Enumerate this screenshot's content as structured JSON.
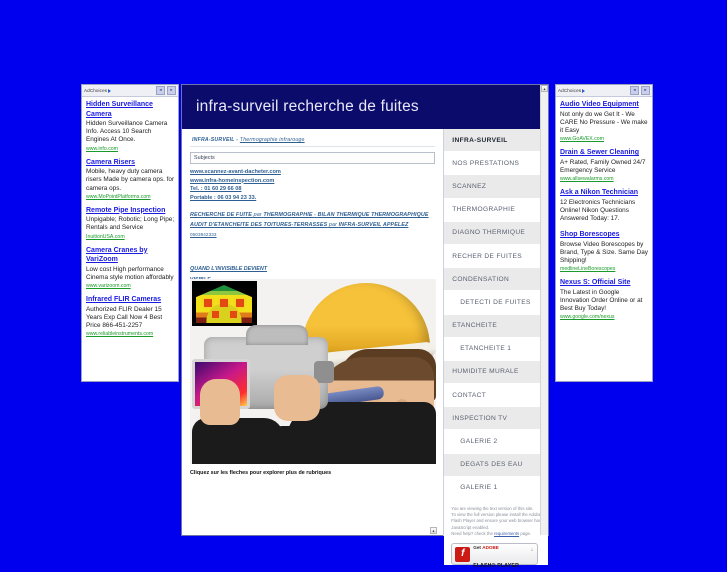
{
  "header": {
    "title": "infra-surveil recherche de fuites"
  },
  "ads_left": {
    "adchoices_label": "AdChoices",
    "prev_label": "◂",
    "next_label": "▸",
    "items": [
      {
        "title": "Hidden Surveillance Camera",
        "body": "Hidden Surveillance Camera Info. Access 10 Search Engines At Once.",
        "url": "www.info.com"
      },
      {
        "title": "Camera Risers",
        "body": "Mobile, heavy duty camera risers Made by camera ops. for camera ops.",
        "url": "www.MoPointPlatforms.com"
      },
      {
        "title": "Remote Pipe Inspection",
        "body": "Unpigable; Robotic; Long Pipe; Rentals and Service",
        "url": "InuitionUSA.com"
      },
      {
        "title": "Camera Cranes by VariZoom",
        "body": "Low cost High performance Cinema style motion affordably",
        "url": "www.varizoom.com"
      },
      {
        "title": "Infrared FLIR Cameras",
        "body": "Authorized FLIR Dealer 15 Years Exp Call Now 4 Best Price 866-451-2257",
        "url": "www.reliableinstruments.com"
      }
    ]
  },
  "ads_right": {
    "adchoices_label": "AdChoices",
    "prev_label": "◂",
    "next_label": "▸",
    "items": [
      {
        "title": "Audio Video Equipment",
        "body": "Not only do we Get It - We CARE No Pressure - We make it Easy",
        "url": "www.GoAVEX.com"
      },
      {
        "title": "Drain & Sewer Cleaning",
        "body": "A+ Rated, Family Owned 24/7 Emergency Service",
        "url": "www.allsewalarms.com"
      },
      {
        "title": "Ask a Nikon Technician",
        "body": "12 Electronics Technicians Online! Nikon Questions Answered Today: 17.",
        "url": ""
      },
      {
        "title": "Shop Borescopes",
        "body": "Browse Video Borescopes by Brand, Type & Size. Same Day Shipping!",
        "url": "medlineLineBorescopes"
      },
      {
        "title": "Nexus S: Official Site",
        "body": "The Latest in Google Innovation Order Online or at Best Buy Today!",
        "url": "www.google.com/nexus"
      }
    ]
  },
  "content": {
    "breadcrumb_site": "INFRA-SURVEIL",
    "breadcrumb_sep": "-",
    "breadcrumb_page": "Thermographie infrarouge",
    "subject_placeholder": "Subjects",
    "links": [
      "www.scannez-avant-dacheter.com",
      "www.infra-homeinspection.com",
      "Tel. : 01 60 29 66 08",
      "Portable : 06 03 94 23 33."
    ],
    "paragraph_line1": "RECHERCHE DE FUITE",
    "paragraph_par1": "par",
    "paragraph_line2": "THERMOGRAPHIE",
    "paragraph_sep": "-",
    "paragraph_line3": "BILAN THERMIQUE THERMOGRAPHIQUE",
    "paragraph_line4": "AUDIT D'ETANCHEITE DES TOITURES-TERRASSES",
    "paragraph_par2": "par",
    "paragraph_line5": "INFRA-SURVEIL",
    "paragraph_line6": "APPELEZ",
    "paragraph_phone": "0603942333",
    "tagline_line1": "QUAND L'INVISIBLE DEVIENT",
    "tagline_line2": "VISIBLE.",
    "photo_alt": "thermographer-photo",
    "caption": "Cliquez sur les fleches pour explorer plus de rubriques"
  },
  "nav": {
    "items": [
      {
        "label": "INFRA-SURVEIL",
        "style": "alt",
        "active": true,
        "sub": false
      },
      {
        "label": "NOS PRESTATIONS",
        "style": "plain",
        "active": false,
        "sub": false
      },
      {
        "label": "SCANNEZ",
        "style": "alt",
        "active": false,
        "sub": false
      },
      {
        "label": "THERMOGRAPHIE",
        "style": "plain",
        "active": false,
        "sub": false
      },
      {
        "label": "DIAGNO THERMIQUE",
        "style": "alt",
        "active": false,
        "sub": false
      },
      {
        "label": "RECHER DE FUITES",
        "style": "plain",
        "active": false,
        "sub": false
      },
      {
        "label": "CONDENSATION",
        "style": "alt",
        "active": false,
        "sub": false
      },
      {
        "label": "DETECTI DE FUITES",
        "style": "plain",
        "active": false,
        "sub": true
      },
      {
        "label": "ETANCHEITE",
        "style": "alt",
        "active": false,
        "sub": false
      },
      {
        "label": "ETANCHEITE 1",
        "style": "plain",
        "active": false,
        "sub": true
      },
      {
        "label": "HUMIDITE MURALE",
        "style": "alt",
        "active": false,
        "sub": false
      },
      {
        "label": "CONTACT",
        "style": "plain",
        "active": false,
        "sub": false
      },
      {
        "label": "INSPECTION TV",
        "style": "alt",
        "active": false,
        "sub": false
      },
      {
        "label": "GALERIE 2",
        "style": "plain",
        "active": false,
        "sub": true
      },
      {
        "label": "DEGATS DES EAU",
        "style": "alt",
        "active": false,
        "sub": true
      },
      {
        "label": "GALERIE 1",
        "style": "plain",
        "active": false,
        "sub": true
      }
    ]
  },
  "flash": {
    "line1": "You are viewing the text version of this site.",
    "line2": "To view the full version please install the Adobe Flash Player and ensure your web browser has JavaScript enabled.",
    "line3_pre": "Need help? check the",
    "line3_link": "requirements",
    "line3_post": "page.",
    "badge_get": "Get",
    "badge_adobe": "ADOBE",
    "badge_reg": "®",
    "badge_player": "FLASH® PLAYER",
    "badge_arrow": "↓"
  },
  "scroll": {
    "up": "▴",
    "down": "▾"
  },
  "colors": {
    "page_background": "#0000ee",
    "header_background": "#0b0b6b",
    "ad_link": "#1a1ae0",
    "ad_url": "#1a9a2a",
    "content_link": "#2e5f92",
    "nav_alt": "#eaeaea"
  }
}
